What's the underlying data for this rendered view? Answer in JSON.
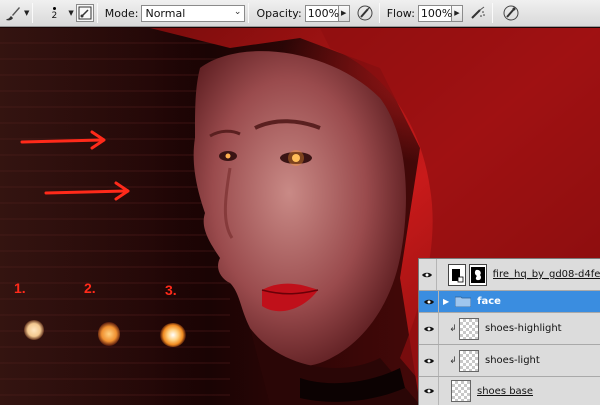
{
  "toolbar": {
    "brush_size": "2",
    "mode_label": "Mode:",
    "mode_value": "Normal",
    "opacity_label": "Opacity:",
    "opacity_value": "100%",
    "flow_label": "Flow:",
    "flow_value": "100%",
    "icons": [
      "brush-icon",
      "brush-panel-icon",
      "pressure-opacity-icon",
      "airbrush-icon",
      "pressure-size-icon"
    ]
  },
  "canvas": {
    "markers": [
      "1.",
      "2.",
      "3."
    ],
    "accent": "#ff2a1a"
  },
  "layers": [
    {
      "name": "fire_hq_by_gd08-d4fer...",
      "type": "smart-object-with-mask",
      "selected": false
    },
    {
      "name": "face",
      "type": "group",
      "selected": true
    },
    {
      "name": "shoes-highlight",
      "type": "clipped",
      "selected": false
    },
    {
      "name": "shoes-light",
      "type": "clipped",
      "selected": false
    },
    {
      "name": "shoes base",
      "type": "normal",
      "selected": false
    }
  ],
  "colors": {
    "selection": "#3a8de0",
    "panel": "#d6d6d6"
  }
}
